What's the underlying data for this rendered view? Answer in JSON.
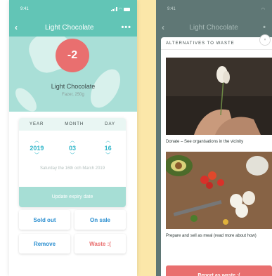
{
  "status": {
    "time": "9:41"
  },
  "left_screen": {
    "header": {
      "title": "Light Chocolate",
      "back_icon": "chevron-left-icon",
      "more_icon": "more-dots-icon"
    },
    "product": {
      "count": "-2",
      "name": "Light Chocolate",
      "sub": "Fazer, 250g"
    },
    "date_picker": {
      "headers": [
        "YEAR",
        "MONTH",
        "DAY"
      ],
      "values": [
        "2019",
        "03",
        "16"
      ],
      "note": "Saturday the 16th och March 2019",
      "update_label": "Update expiry date"
    },
    "actions": {
      "sold_out": "Sold out",
      "on_sale": "On sale",
      "remove": "Remove",
      "waste": "Waste :("
    }
  },
  "right_screen": {
    "header": {
      "title": "Light Chocolate"
    },
    "sheet_title": "ALTERNATIVES TO WASTE",
    "alternatives": [
      {
        "caption": "Donate – See organisations in the vicinity"
      },
      {
        "caption": "Prepare and sell as meal (read more about how)"
      }
    ],
    "report_label": "Report as waste :("
  },
  "colors": {
    "teal": "#62c5b6",
    "accent_blue": "#2b8fd0",
    "danger_red": "#e96f6f",
    "background_yellow": "#fbe7a9"
  }
}
